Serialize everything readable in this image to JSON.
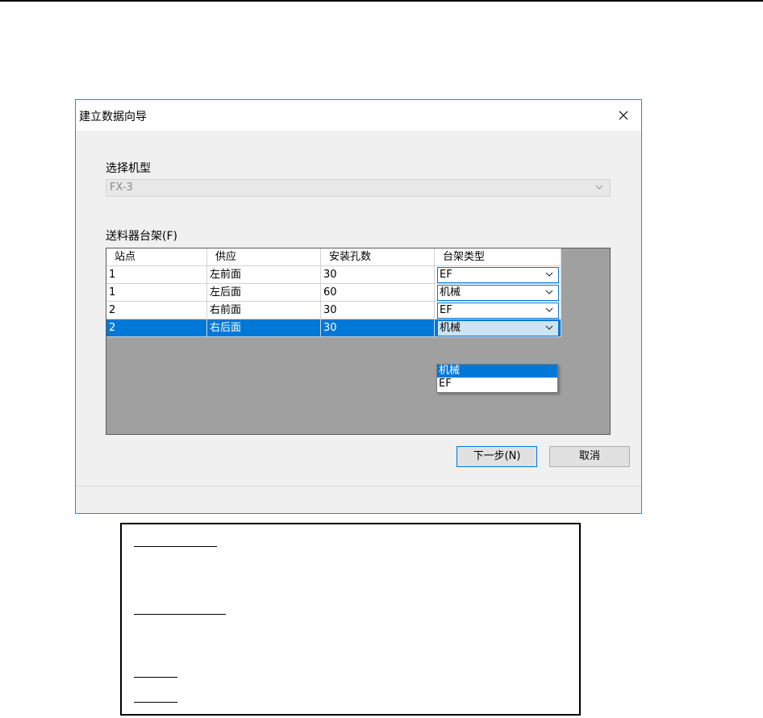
{
  "dialog": {
    "title": "建立数据向导",
    "model_label": "选择机型",
    "model_value": "FX-3",
    "feeder_label": "送料器台架(F)",
    "columns": [
      "站点",
      "供应",
      "安装孔数",
      "台架类型"
    ],
    "rows": [
      {
        "station": "1",
        "supply": "左前面",
        "holes": "30",
        "type": "EF"
      },
      {
        "station": "1",
        "supply": "左后面",
        "holes": "60",
        "type": "机械"
      },
      {
        "station": "2",
        "supply": "右前面",
        "holes": "30",
        "type": "EF"
      },
      {
        "station": "2",
        "supply": "右后面",
        "holes": "30",
        "type": "机械"
      }
    ],
    "dropdown_options": [
      "机械",
      "EF"
    ],
    "next_label": "下一步(N)",
    "cancel_label": "取消"
  },
  "colors": {
    "accent": "#0078d7",
    "dialog_bg": "#f0f0f0",
    "grid_bg": "#a0a0a0"
  },
  "icons": {
    "close": "close-icon",
    "chevron": "chevron-down-icon"
  }
}
